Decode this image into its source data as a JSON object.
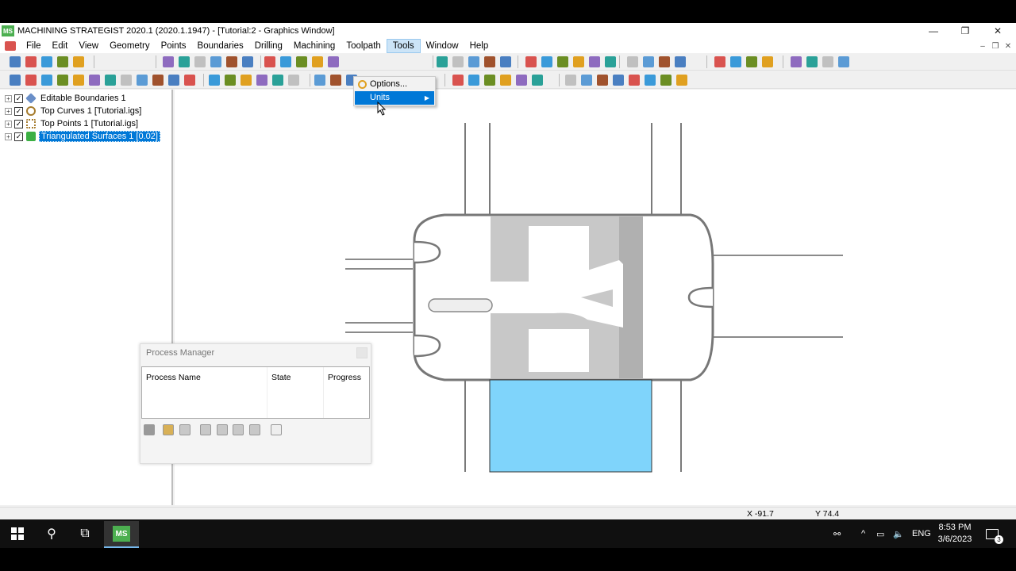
{
  "window": {
    "title": "MACHINING STRATEGIST 2020.1 (2020.1.1947) - [Tutorial:2 - Graphics Window]",
    "logo_text": "MS",
    "minimize": "—",
    "restore": "❐",
    "close": "✕"
  },
  "menu": {
    "items": [
      "File",
      "Edit",
      "View",
      "Geometry",
      "Points",
      "Boundaries",
      "Drilling",
      "Machining",
      "Toolpath",
      "Tools",
      "Window",
      "Help"
    ],
    "active": "Tools",
    "mdi_minimize": "‒",
    "mdi_restore": "❐",
    "mdi_close": "✕"
  },
  "tools_dropdown": {
    "items": [
      {
        "label": "Options...",
        "icon": "options-icon"
      },
      {
        "label": "Units",
        "has_submenu": true
      }
    ],
    "submenu_arrow": "▶"
  },
  "tree": {
    "items": [
      {
        "label": "Editable Boundaries 1",
        "checked": true,
        "icon": "boundary-icon",
        "selected": false
      },
      {
        "label": "Top Curves 1 [Tutorial.igs]",
        "checked": true,
        "icon": "curves-icon",
        "selected": false
      },
      {
        "label": "Top Points 1 [Tutorial.igs]",
        "checked": true,
        "icon": "points-icon",
        "selected": false
      },
      {
        "label": "Triangulated Surfaces 1 [0.02]",
        "checked": true,
        "icon": "surface-icon",
        "selected": true
      }
    ],
    "expand_glyph": "+",
    "check_glyph": "✓"
  },
  "process_manager": {
    "title": "Process Manager",
    "columns": [
      "Process Name",
      "State",
      "Progress"
    ]
  },
  "status": {
    "x": "X -91.7",
    "y": "Y 74.4"
  },
  "taskbar": {
    "start_icon": "windows-start-icon",
    "search_glyph": "⚲",
    "taskview_glyph": "⧉",
    "app_label": "MS",
    "tray_person": "⚯",
    "tray_chevron": "^",
    "tray_network": "▭",
    "tray_volume": "🔈",
    "language": "ENG",
    "time": "8:53 PM",
    "date": "3/6/2023",
    "notification_count": "3"
  },
  "colors": {
    "accent": "#0078d7",
    "highlight_face": "#7fd4fb",
    "logo_green": "#4caf50"
  }
}
